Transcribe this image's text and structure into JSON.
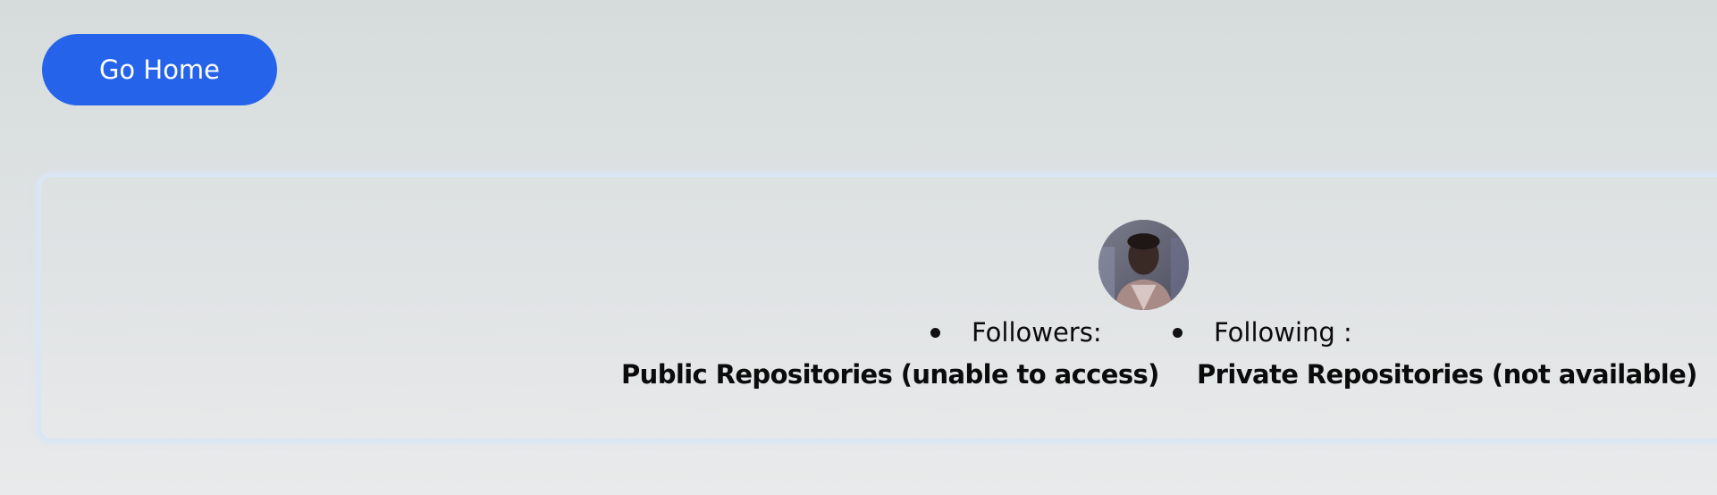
{
  "nav": {
    "home_button_label": "Go Home"
  },
  "profile": {
    "avatar_alt": "avatar",
    "followers_label": "Followers:",
    "following_label": "Following :",
    "public_repos_label": "Public Repositories (unable to access)",
    "private_repos_label": "Private Repositories (not available)"
  },
  "colors": {
    "primary_button": "#2563eb",
    "card_border": "#dbe6f5",
    "text": "#0b0b0b"
  }
}
